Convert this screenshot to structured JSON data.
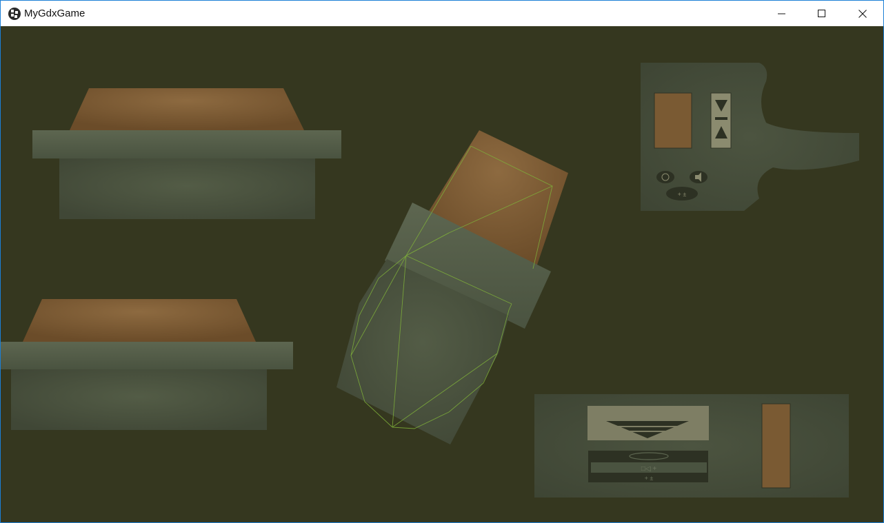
{
  "window": {
    "title": "MyGdxGame",
    "icon": "libgdx-logo-icon",
    "controls": [
      "minimize",
      "maximize",
      "close"
    ]
  },
  "scene": {
    "background_color": "#35371f",
    "wood_color": "#7a5a33",
    "metal_color": "#56604a",
    "wireframe_color": "#7fb03a"
  }
}
